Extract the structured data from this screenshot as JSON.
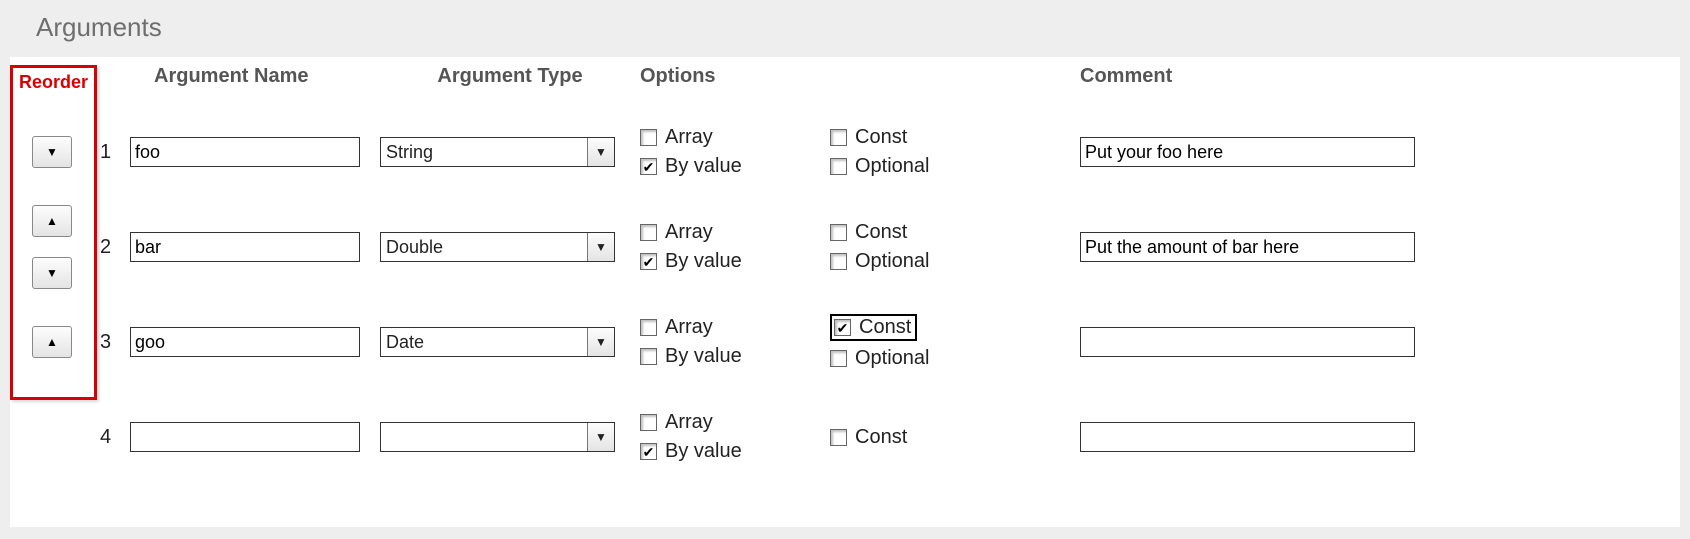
{
  "title": "Arguments",
  "annotation": {
    "label": "Reorder"
  },
  "headers": {
    "name": "Argument Name",
    "type": "Argument Type",
    "options": "Options",
    "comment": "Comment"
  },
  "option_labels": {
    "array": "Array",
    "by_value": "By value",
    "const": "Const",
    "optional": "Optional"
  },
  "rows": [
    {
      "index": "1",
      "reorder": {
        "up": false,
        "down": true
      },
      "name": "foo",
      "type": "String",
      "opts": {
        "array": false,
        "by_value": true,
        "const": false,
        "optional": false,
        "show_optional": true,
        "const_highlight": false
      },
      "comment": "Put your foo here"
    },
    {
      "index": "2",
      "reorder": {
        "up": true,
        "down": true
      },
      "name": "bar",
      "type": "Double",
      "opts": {
        "array": false,
        "by_value": true,
        "const": false,
        "optional": false,
        "show_optional": true,
        "const_highlight": false
      },
      "comment": "Put the amount of bar here"
    },
    {
      "index": "3",
      "reorder": {
        "up": true,
        "down": false
      },
      "name": "goo",
      "type": "Date",
      "opts": {
        "array": false,
        "by_value": false,
        "const": true,
        "optional": false,
        "show_optional": true,
        "const_highlight": true
      },
      "comment": ""
    },
    {
      "index": "4",
      "reorder": {
        "up": false,
        "down": false
      },
      "name": "",
      "type": "",
      "opts": {
        "array": false,
        "by_value": true,
        "const": false,
        "optional": false,
        "show_optional": false,
        "const_highlight": false
      },
      "comment": ""
    }
  ]
}
